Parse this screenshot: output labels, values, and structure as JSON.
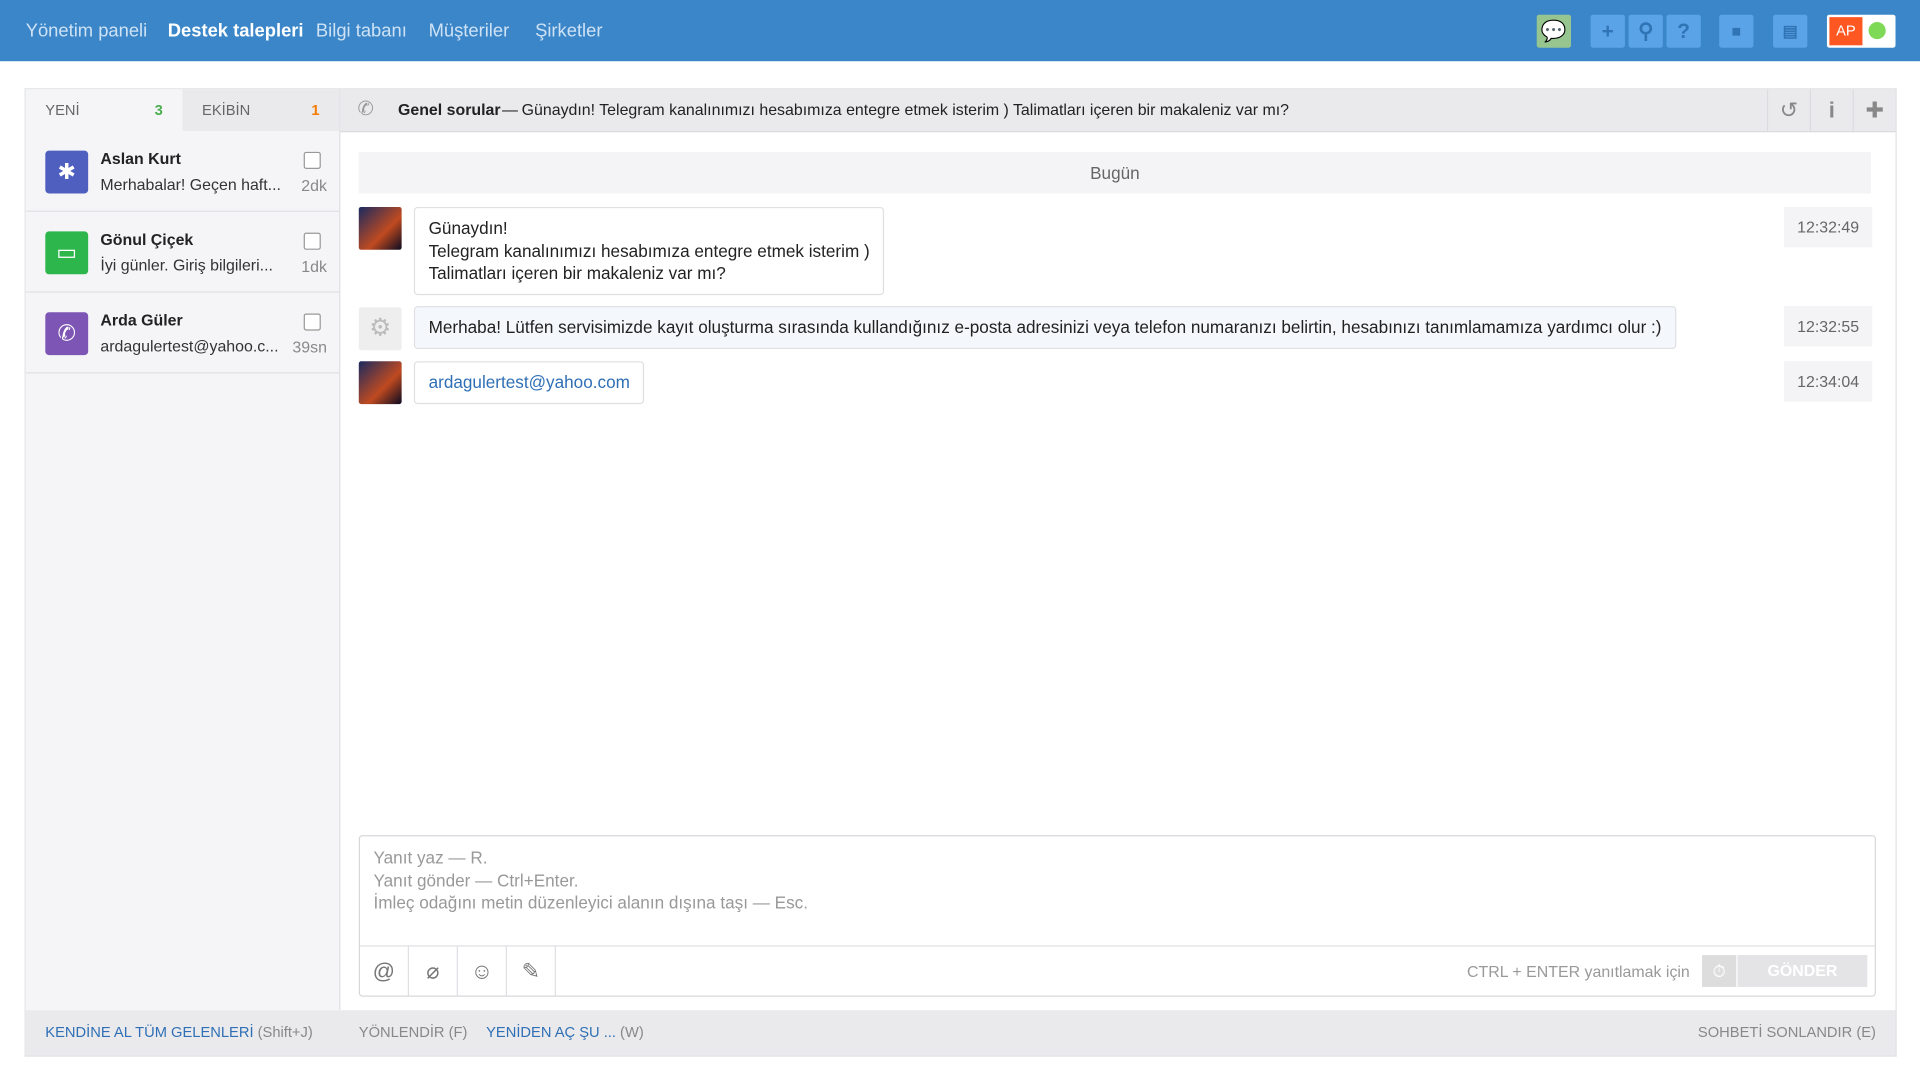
{
  "nav": [
    "Yönetim paneli",
    "Destek talepleri",
    "Bilgi tabanı",
    "Müşteriler",
    "Şirketler"
  ],
  "user": {
    "initials": "AP",
    "status_color": "#7ed957"
  },
  "colors": {
    "brand": "#3a86c8",
    "accent_green": "#4caf50",
    "accent_orange": "#f57c00"
  },
  "tabs": [
    {
      "label": "YENİ",
      "count": "3"
    },
    {
      "label": "EKİBİN",
      "count": "1"
    }
  ],
  "conversations": [
    {
      "name": "Aslan Kurt",
      "preview": "Merhabalar! Geçen haft...",
      "time": "2dk",
      "channel": "slack-icon"
    },
    {
      "name": "Gönul Çiçek",
      "preview": "İyi günler. Giriş bilgileri...",
      "time": "1dk",
      "channel": "line-icon"
    },
    {
      "name": "Arda Güler",
      "preview": "ardagulertest@yahoo.c...",
      "time": "39sn",
      "channel": "viber-icon"
    }
  ],
  "chat": {
    "topic": "Genel sorular",
    "separator": "—",
    "subject": "Günaydın! Telegram kanalınımızı hesabımıza entegre etmek isterim ) Talimatları içeren bir makaleniz var mı?",
    "day": "Bugün",
    "messages": [
      {
        "lines": [
          "Günaydın!",
          "Telegram kanalınımızı hesabımıza entegre etmek isterim )",
          "Talimatları içeren bir makaleniz var mı?"
        ],
        "time": "12:32:49"
      },
      {
        "text": "Merhaba! Lütfen servisimizde kayıt oluşturma sırasında kullandığınız e-posta adresinizi veya telefon numaranızı belirtin, hesabınızı tanımlamamıza yardımcı olur :)",
        "time": "12:32:55"
      },
      {
        "text": "ardagulertest@yahoo.com",
        "time": "12:34:04"
      }
    ]
  },
  "editor": {
    "placeholder": [
      "Yanıt yaz — R.",
      "Yanıt gönder — Ctrl+Enter.",
      "İmleç odağını metin düzenleyici alanın dışına taşı — Esc."
    ],
    "hint": "CTRL + ENTER yanıtlamak için",
    "send": "GÖNDER"
  },
  "footer": {
    "take_all": "KENDİNE AL TÜM GELENLERİ",
    "take_all_key": "(Shift+J)",
    "forward": "YÖNLENDİR (F)",
    "reopen": "YENİDEN AÇ ŞU ...",
    "reopen_key": "(W)",
    "end": "SOHBETİ SONLANDIR (E)"
  }
}
